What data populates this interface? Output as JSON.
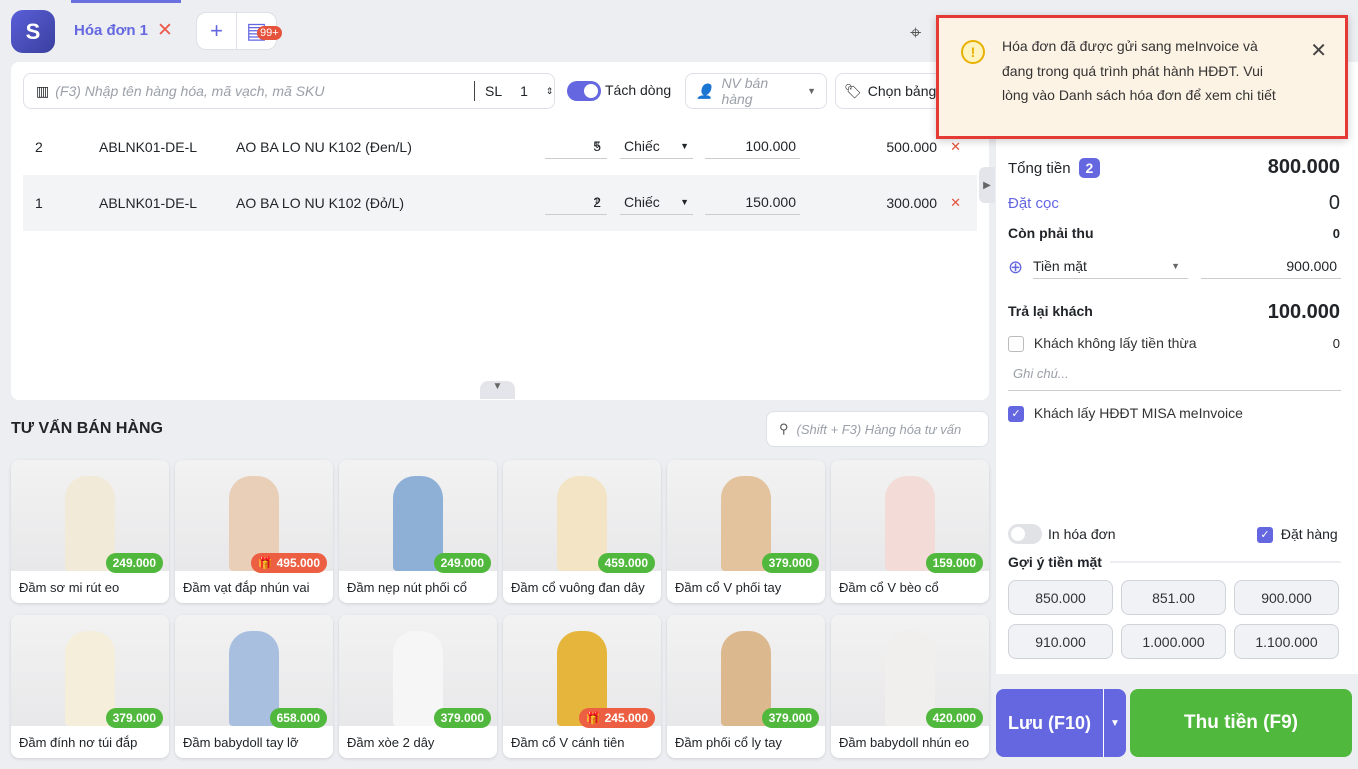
{
  "tabs": {
    "active_label": "Hóa đơn 1",
    "badge": "99+"
  },
  "search": {
    "placeholder": "(F3) Nhập tên hàng hóa, mã vạch, mã SKU",
    "qty_label": "SL",
    "qty": "1"
  },
  "split_line_label": "Tách dòng",
  "salesperson_placeholder": "NV bán hàng",
  "price_list_label": "Chọn bảng",
  "rows": [
    {
      "no": "2",
      "sku": "ABLNK01-DE-L",
      "name": "AO BA LO NU K102 (Đen/L)",
      "qty": "5",
      "unit": "Chiếc",
      "price": "100.000",
      "total": "500.000"
    },
    {
      "no": "1",
      "sku": "ABLNK01-DE-L",
      "name": "AO BA LO NU K102 (Đỏ/L)",
      "qty": "2",
      "unit": "Chiếc",
      "price": "150.000",
      "total": "300.000"
    }
  ],
  "advice": {
    "title": "TƯ VẤN BÁN HÀNG",
    "search_placeholder": "(Shift + F3) Hàng hóa tư vấn"
  },
  "products": [
    {
      "name": "Đầm sơ mi rút eo",
      "price": "249.000",
      "promo": false,
      "color": "#f1ead8"
    },
    {
      "name": "Đầm vạt đắp nhún vai",
      "price": "495.000",
      "promo": true,
      "color": "#e9cfb8"
    },
    {
      "name": "Đầm nẹp nút phối cổ",
      "price": "249.000",
      "promo": false,
      "color": "#8fb0d6"
    },
    {
      "name": "Đầm cổ vuông đan dây",
      "price": "459.000",
      "promo": false,
      "color": "#f4e4c6"
    },
    {
      "name": "Đầm cổ V phối tay",
      "price": "379.000",
      "promo": false,
      "color": "#e3c39e"
    },
    {
      "name": "Đầm cổ V bèo cổ",
      "price": "159.000",
      "promo": false,
      "color": "#f3dcd8"
    },
    {
      "name": "Đầm đính nơ túi đắp",
      "price": "379.000",
      "promo": false,
      "color": "#f5eedb"
    },
    {
      "name": "Đầm babydoll tay lỡ",
      "price": "658.000",
      "promo": false,
      "color": "#a9bfdf"
    },
    {
      "name": "Đầm xòe 2 dây",
      "price": "379.000",
      "promo": false,
      "color": "#f6f6f6"
    },
    {
      "name": "Đầm cổ V cánh tiên",
      "price": "245.000",
      "promo": true,
      "color": "#e5b53c"
    },
    {
      "name": "Đầm phối cổ ly tay",
      "price": "379.000",
      "promo": false,
      "color": "#dcb88e"
    },
    {
      "name": "Đầm babydoll nhún eo",
      "price": "420.000",
      "promo": false,
      "color": "#f1efee"
    }
  ],
  "summary": {
    "total_label": "Tổng tiền",
    "total_count": "2",
    "total": "800.000",
    "deposit_label": "Đặt cọc",
    "deposit": "0",
    "remaining_label": "Còn phải thu",
    "remaining": "0",
    "method": "Tiền mặt",
    "method_amount": "900.000",
    "change_label": "Trả lại khách",
    "change": "100.000",
    "no_change_label": "Khách không lấy tiền thừa",
    "no_change": "0",
    "note_placeholder": "Ghi chú...",
    "einvoice_label": "Khách lấy HĐĐT MISA meInvoice",
    "print_label": "In hóa đơn",
    "order_label": "Đặt hàng",
    "cash_suggest_label": "Gợi ý tiền mặt",
    "cash_suggestions": [
      "850.000",
      "851.00",
      "900.000",
      "910.000",
      "1.000.000",
      "1.100.000"
    ]
  },
  "buttons": {
    "save": "Lưu (F10)",
    "pay": "Thu tiền (F9)"
  },
  "toast": {
    "message": "Hóa đơn đã được gửi sang meInvoice và đang trong quá trình phát hành HĐĐT.  Vui lòng vào Danh sách hóa đơn để xem chi tiết"
  },
  "colors": {
    "accent": "#6467e0",
    "green": "#50b83c",
    "promo": "#ec5f42"
  }
}
